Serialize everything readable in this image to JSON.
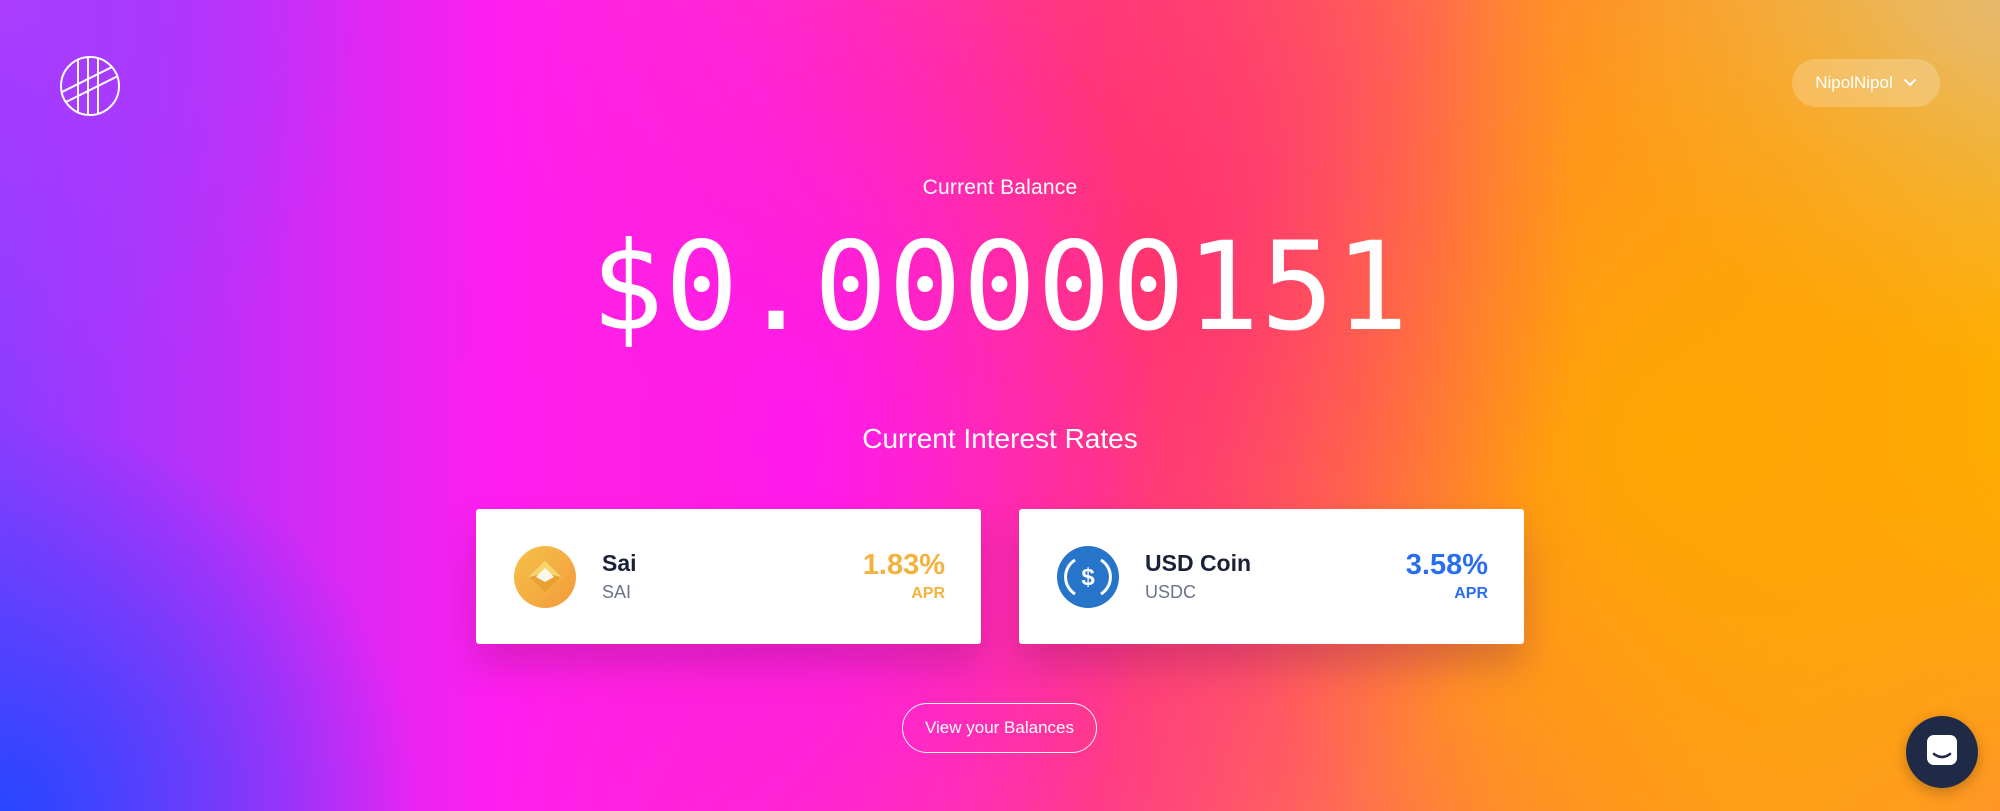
{
  "header": {
    "logo_icon": "striped-circle-logo-icon",
    "user_menu": {
      "label": "NipolNipol",
      "icon": "chevron-down-icon"
    }
  },
  "balance": {
    "label": "Current Balance",
    "value": "$0.00000151"
  },
  "rates": {
    "title": "Current Interest Rates",
    "cards": [
      {
        "name": "Sai",
        "symbol": "SAI",
        "rate": "1.83%",
        "rate_label": "APR",
        "icon": "sai-coin-icon",
        "color": "#f3b23d"
      },
      {
        "name": "USD Coin",
        "symbol": "USDC",
        "rate": "3.58%",
        "rate_label": "APR",
        "icon": "usdc-coin-icon",
        "color": "#2a6ef0"
      }
    ]
  },
  "actions": {
    "view_balances_label": "View your Balances"
  },
  "chat": {
    "icon": "chat-icon"
  }
}
